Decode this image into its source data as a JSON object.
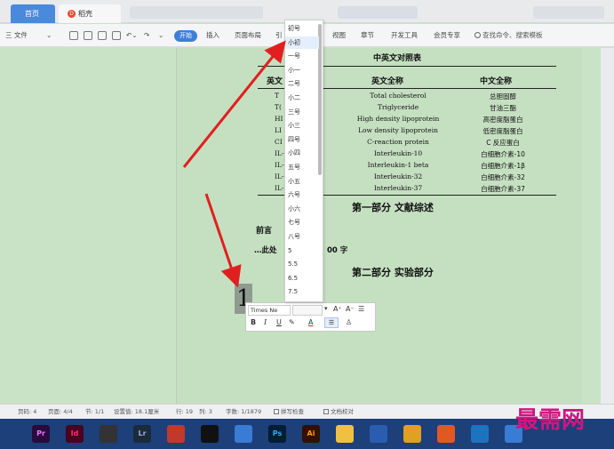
{
  "tabs": {
    "home": "首页",
    "docer": "稻壳"
  },
  "menu": {
    "file": "三 文件",
    "start": "开始",
    "insert": "插入",
    "layout": "页面布局",
    "ref": "引",
    "view": "视图",
    "chapter": "章节",
    "dev": "开发工具",
    "member": "会员专享",
    "search": "查找命令、搜索模板"
  },
  "font_sizes": [
    "初号",
    "小初",
    "一号",
    "小一",
    "二号",
    "小二",
    "三号",
    "小三",
    "四号",
    "小四",
    "五号",
    "小五",
    "六号",
    "小六",
    "七号",
    "八号",
    "5",
    "5.5",
    "6.5",
    "7.5"
  ],
  "selected_size": "小初",
  "document": {
    "table_title": "中英文对照表",
    "col_abbr": "英文",
    "col_en": "英文全称",
    "col_zh": "中文全称",
    "rows": [
      {
        "abbr": "T",
        "en": "Total cholesterol",
        "zh": "总胆固醇"
      },
      {
        "abbr": "T(",
        "en": "Triglyceride",
        "zh": "甘油三酯"
      },
      {
        "abbr": "HI",
        "en": "High density lipoprotein",
        "zh": "高密度脂蛋白"
      },
      {
        "abbr": "LI",
        "en": "Low density lipoprotein",
        "zh": "低密度脂蛋白"
      },
      {
        "abbr": "CI",
        "en": "C-reaction protein",
        "zh": "C 反应蛋白"
      },
      {
        "abbr": "IL-",
        "en": "Interleukin-10",
        "zh": "白细胞介素-10"
      },
      {
        "abbr": "IL-",
        "en": "Interleukin-1 beta",
        "zh": "白细胞介素-1β"
      },
      {
        "abbr": "IL-",
        "en": "Interleukin-32",
        "zh": "白细胞介素-32"
      },
      {
        "abbr": "IL-",
        "en": "Interleukin-37",
        "zh": "白细胞介素-37"
      }
    ],
    "part1": "第一部分  文献综述",
    "preface": "前言",
    "preface_note": "…此处",
    "preface_tail": "00 字",
    "part2": "第二部分  实验部分",
    "cursor_number": "1"
  },
  "mini_toolbar": {
    "font_name": "Times Ne",
    "grow": "A⁺",
    "shrink": "A⁻",
    "bold": "B",
    "italic": "I",
    "underline": "U",
    "font_color": "A"
  },
  "status": {
    "page": "页码: 4",
    "pages": "页面: 4/4",
    "section": "节: 1/1",
    "setting": "设置值: 18.1厘米",
    "row": "行: 19",
    "col": "列: 3",
    "words": "字数: 1/1879",
    "spell": "拼写检查",
    "proof": "文档校对"
  },
  "taskbar_apps": [
    "Pr",
    "Id",
    "",
    "Lr",
    "",
    "",
    "",
    "Ps",
    "Ai",
    "",
    "",
    "",
    "",
    "",
    ""
  ],
  "watermark": "最需网"
}
